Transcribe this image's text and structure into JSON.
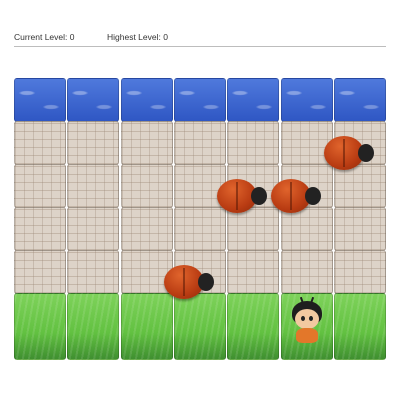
{
  "hud": {
    "current_level_label": "Current Level: 0",
    "highest_level_label": "Highest Level: 0"
  },
  "board": {
    "columns": 7,
    "row_types": [
      "water",
      "stone",
      "stone",
      "stone",
      "stone",
      "grass"
    ],
    "enemies": [
      {
        "name": "ladybug",
        "row": 1,
        "col": 6
      },
      {
        "name": "ladybug",
        "row": 2,
        "col": 4
      },
      {
        "name": "ladybug",
        "row": 2,
        "col": 5
      },
      {
        "name": "ladybug",
        "row": 4,
        "col": 3
      }
    ],
    "player": {
      "name": "player-character",
      "row": 5,
      "col": 5
    }
  },
  "colors": {
    "water": "#3a63cf",
    "stone": "#ddd3c8",
    "grass": "#62c141",
    "ladybug": "#c2441a",
    "player_shirt": "#e3772a"
  }
}
